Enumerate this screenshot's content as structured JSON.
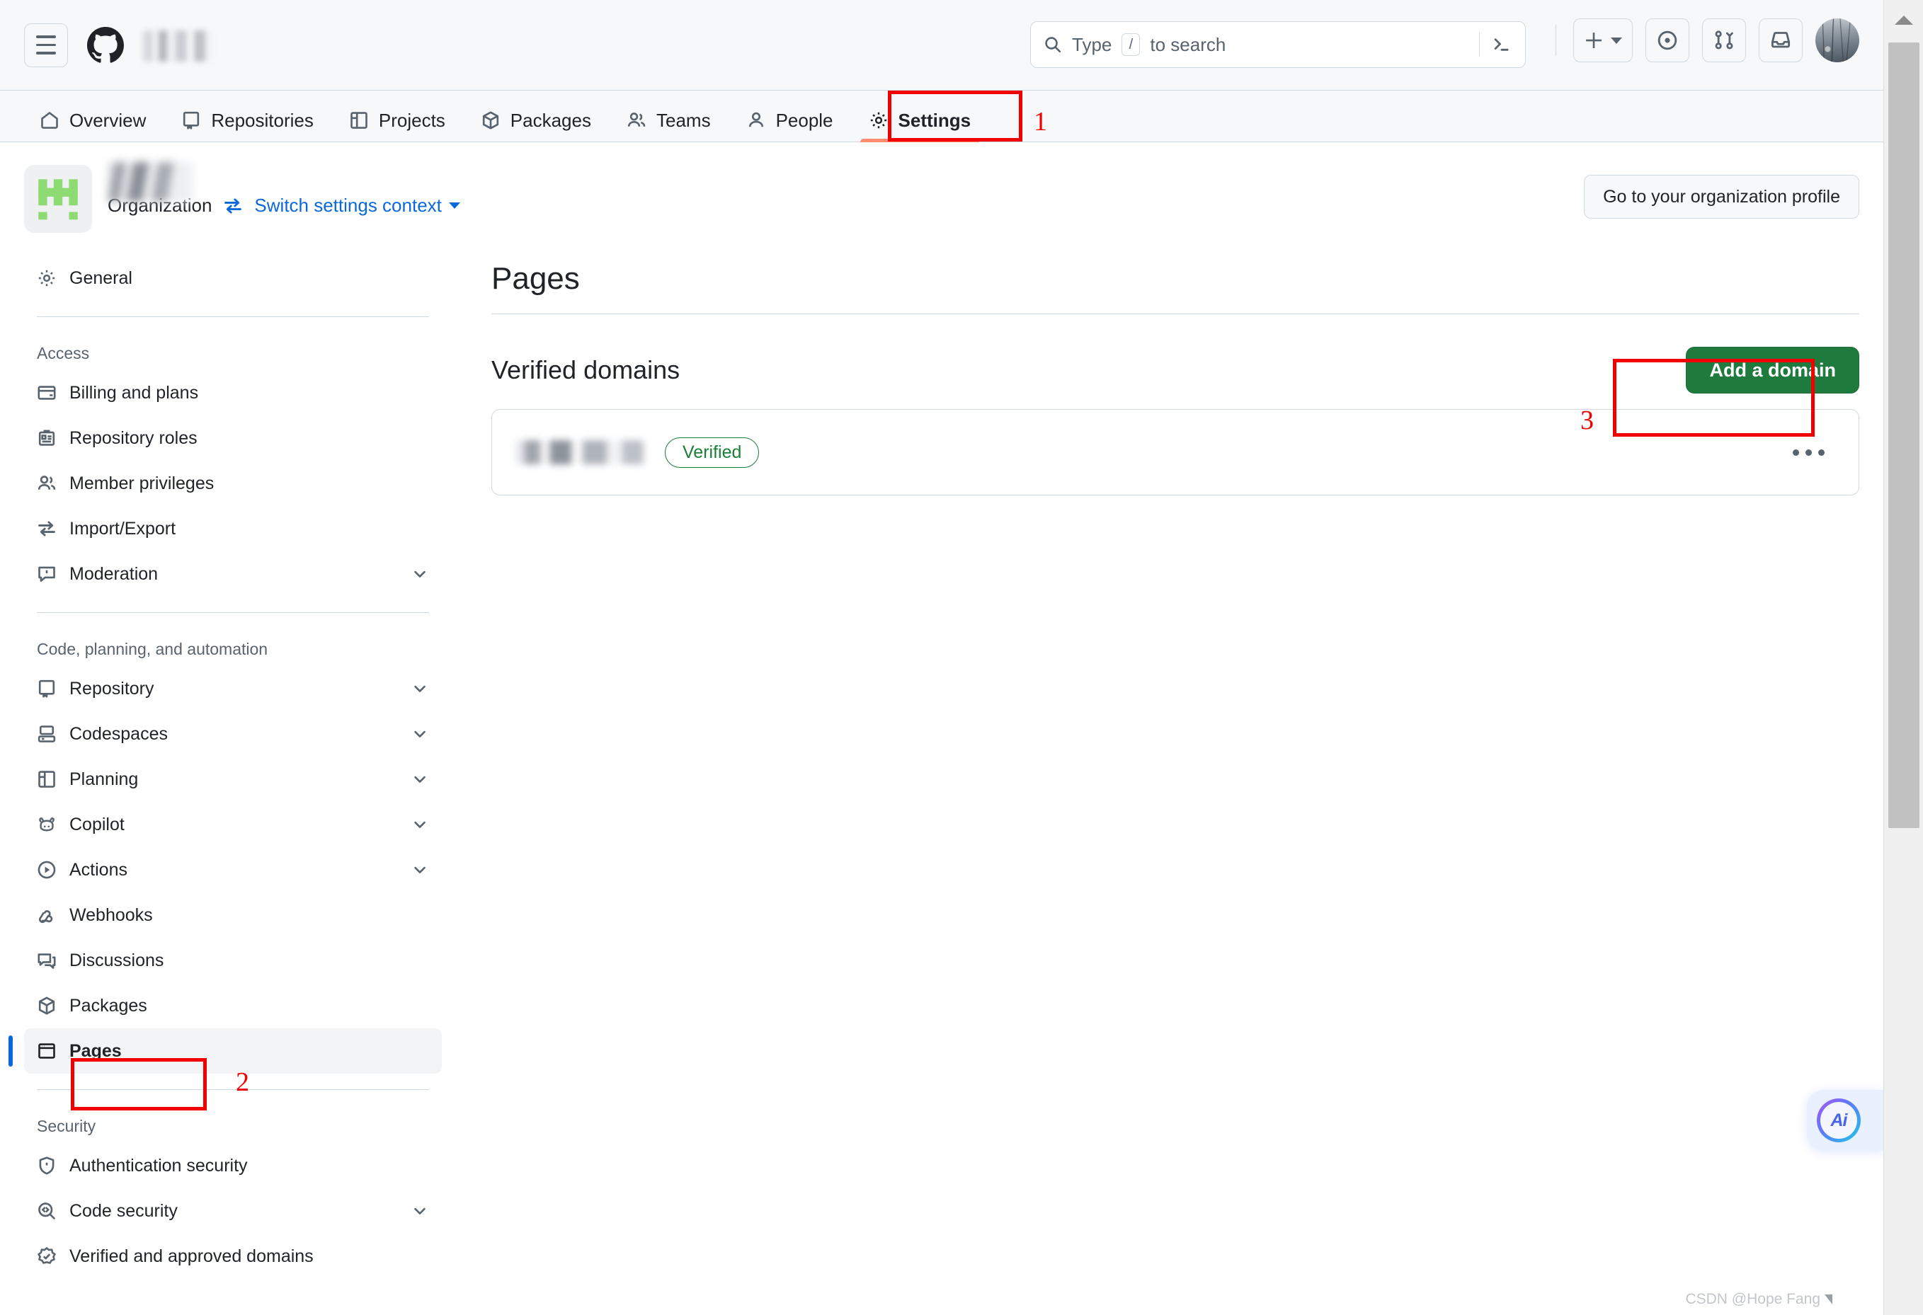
{
  "header": {
    "menu_icon": "hamburger-icon",
    "logo_icon": "github-logo-icon",
    "org_name_blurred": "",
    "search": {
      "placeholder_prefix": "Type",
      "slash_key": "/",
      "placeholder_suffix": "to search",
      "terminal_icon": "command-palette-icon"
    },
    "actions": [
      {
        "name": "create-new-button",
        "icon": "plus-icon"
      },
      {
        "name": "issues-button",
        "icon": "issue-opened-icon"
      },
      {
        "name": "pull-requests-button",
        "icon": "git-pull-request-icon"
      },
      {
        "name": "notifications-button",
        "icon": "inbox-icon"
      },
      {
        "name": "user-avatar",
        "icon": "avatar-image"
      }
    ]
  },
  "nav": {
    "tabs": [
      {
        "label": "Overview",
        "icon": "home-icon",
        "active": false
      },
      {
        "label": "Repositories",
        "icon": "repo-icon",
        "active": false
      },
      {
        "label": "Projects",
        "icon": "project-icon",
        "active": false
      },
      {
        "label": "Packages",
        "icon": "package-icon",
        "active": false
      },
      {
        "label": "Teams",
        "icon": "people-icon",
        "active": false
      },
      {
        "label": "People",
        "icon": "person-icon",
        "active": false
      },
      {
        "label": "Settings",
        "icon": "gear-icon",
        "active": true
      }
    ]
  },
  "org": {
    "avatar_icon": "organization-avatar",
    "name_blurred": "",
    "type_label": "Organization",
    "switch_icon": "arrow-switch-icon",
    "switch_label": "Switch settings context",
    "profile_button": "Go to your organization profile"
  },
  "sidebar": {
    "top": [
      {
        "label": "General",
        "icon": "gear-icon",
        "chevron": false,
        "current": false
      }
    ],
    "groups": [
      {
        "title": "Access",
        "items": [
          {
            "label": "Billing and plans",
            "icon": "credit-card-icon",
            "chevron": false,
            "current": false
          },
          {
            "label": "Repository roles",
            "icon": "id-badge-icon",
            "chevron": false,
            "current": false
          },
          {
            "label": "Member privileges",
            "icon": "people-icon",
            "chevron": false,
            "current": false
          },
          {
            "label": "Import/Export",
            "icon": "arrow-switch-icon",
            "chevron": false,
            "current": false
          },
          {
            "label": "Moderation",
            "icon": "report-icon",
            "chevron": true,
            "current": false
          }
        ]
      },
      {
        "title": "Code, planning, and automation",
        "items": [
          {
            "label": "Repository",
            "icon": "repo-icon",
            "chevron": true,
            "current": false
          },
          {
            "label": "Codespaces",
            "icon": "codespaces-icon",
            "chevron": true,
            "current": false
          },
          {
            "label": "Planning",
            "icon": "project-icon",
            "chevron": true,
            "current": false
          },
          {
            "label": "Copilot",
            "icon": "copilot-icon",
            "chevron": true,
            "current": false
          },
          {
            "label": "Actions",
            "icon": "play-icon",
            "chevron": true,
            "current": false
          },
          {
            "label": "Webhooks",
            "icon": "webhook-icon",
            "chevron": false,
            "current": false
          },
          {
            "label": "Discussions",
            "icon": "comment-discussion-icon",
            "chevron": false,
            "current": false
          },
          {
            "label": "Packages",
            "icon": "package-icon",
            "chevron": false,
            "current": false
          },
          {
            "label": "Pages",
            "icon": "browser-icon",
            "chevron": false,
            "current": true
          }
        ]
      },
      {
        "title": "Security",
        "items": [
          {
            "label": "Authentication security",
            "icon": "shield-lock-icon",
            "chevron": false,
            "current": false
          },
          {
            "label": "Code security",
            "icon": "codescan-icon",
            "chevron": true,
            "current": false
          },
          {
            "label": "Verified and approved domains",
            "icon": "verified-icon",
            "chevron": false,
            "current": false
          }
        ]
      }
    ]
  },
  "main": {
    "title": "Pages",
    "section_title": "Verified domains",
    "add_button": "Add a domain",
    "domains": [
      {
        "name_blurred": "",
        "badge": "Verified",
        "menu_icon": "kebab-horizontal-icon"
      }
    ]
  },
  "annotations": [
    {
      "number": "1",
      "target": "settings-tab"
    },
    {
      "number": "2",
      "target": "pages-sidebar-item"
    },
    {
      "number": "3",
      "target": "add-a-domain-button"
    }
  ],
  "ai_widget": {
    "label": "Ai"
  },
  "watermark": {
    "text": "CSDN @Hope Fang"
  }
}
